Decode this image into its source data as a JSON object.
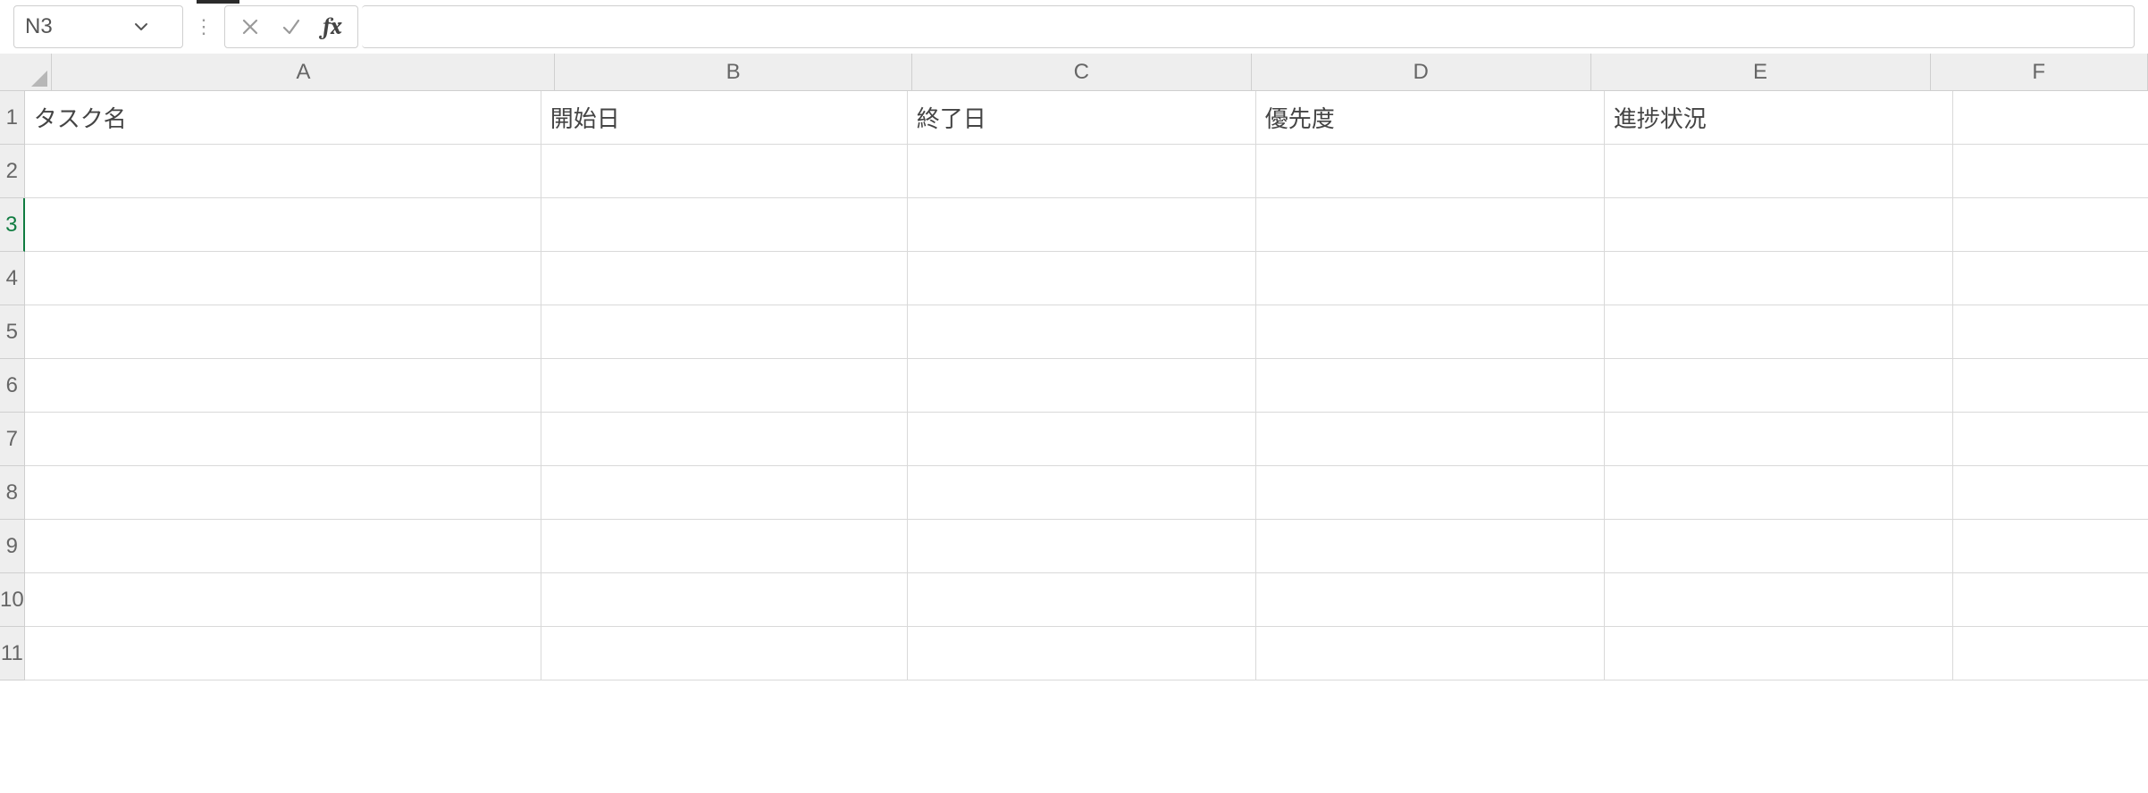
{
  "name_box": {
    "value": "N3"
  },
  "formula_bar": {
    "value": "",
    "fx_label": "fx"
  },
  "columns": [
    "A",
    "B",
    "C",
    "D",
    "E",
    "F"
  ],
  "rows": [
    "1",
    "2",
    "3",
    "4",
    "5",
    "6",
    "7",
    "8",
    "9",
    "10",
    "11"
  ],
  "active_row_index": 2,
  "cell_values": {
    "A1": "タスク名",
    "B1": "開始日",
    "C1": "終了日",
    "D1": "優先度",
    "E1": "進捗状況"
  },
  "icons": {
    "chevron_down": "chevron-down-icon",
    "cancel": "cancel-icon",
    "confirm": "confirm-icon",
    "fx": "fx-icon",
    "dots": "more-dots-icon"
  }
}
